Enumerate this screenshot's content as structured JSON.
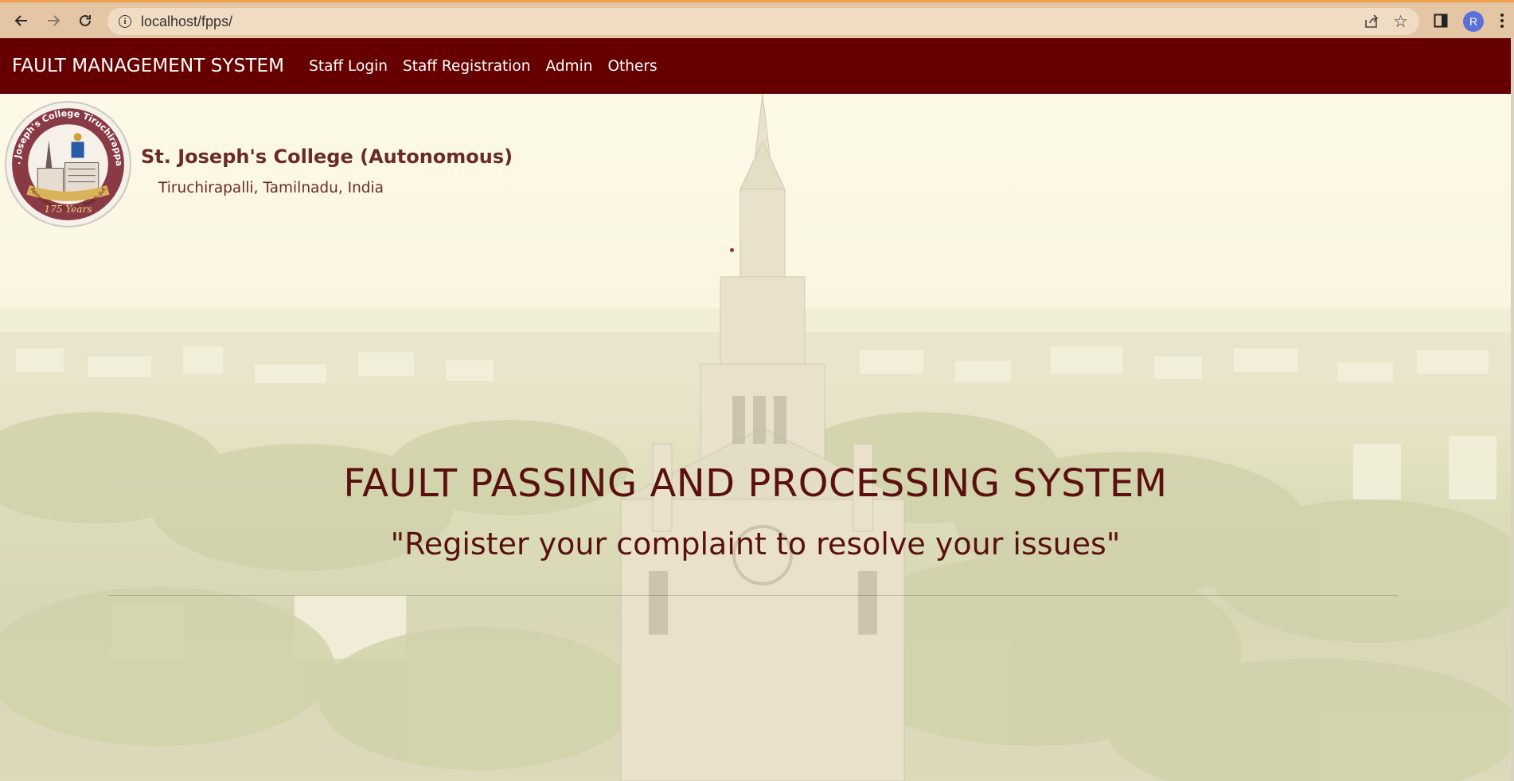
{
  "browser": {
    "url": "localhost/fpps/",
    "profile_initial": "R",
    "icons": [
      "back-arrow",
      "forward-arrow",
      "reload",
      "info",
      "share",
      "star",
      "side-panel",
      "kebab-menu"
    ]
  },
  "navbar": {
    "brand": "FAULT MANAGEMENT SYSTEM",
    "links": [
      "Staff Login",
      "Staff Registration",
      "Admin",
      "Others"
    ],
    "background": "#660000"
  },
  "header": {
    "college_name": "St. Joseph's College (Autonomous)",
    "college_location": "Tiruchirapalli, Tamilnadu, India",
    "logo": {
      "top_text": "St. Joseph's College Tiruchirappalli",
      "bottom_text": "Remember - Rejoice - Reach out",
      "badge": "175 Years"
    }
  },
  "hero": {
    "title": "FAULT PASSING AND PROCESSING SYSTEM",
    "tagline": "\"Register your complaint to resolve your issues\""
  },
  "colors": {
    "accent": "#660000",
    "hero_text": "#5a1010",
    "college_text": "#6b2a2a",
    "chrome": "#e4c6a4"
  }
}
